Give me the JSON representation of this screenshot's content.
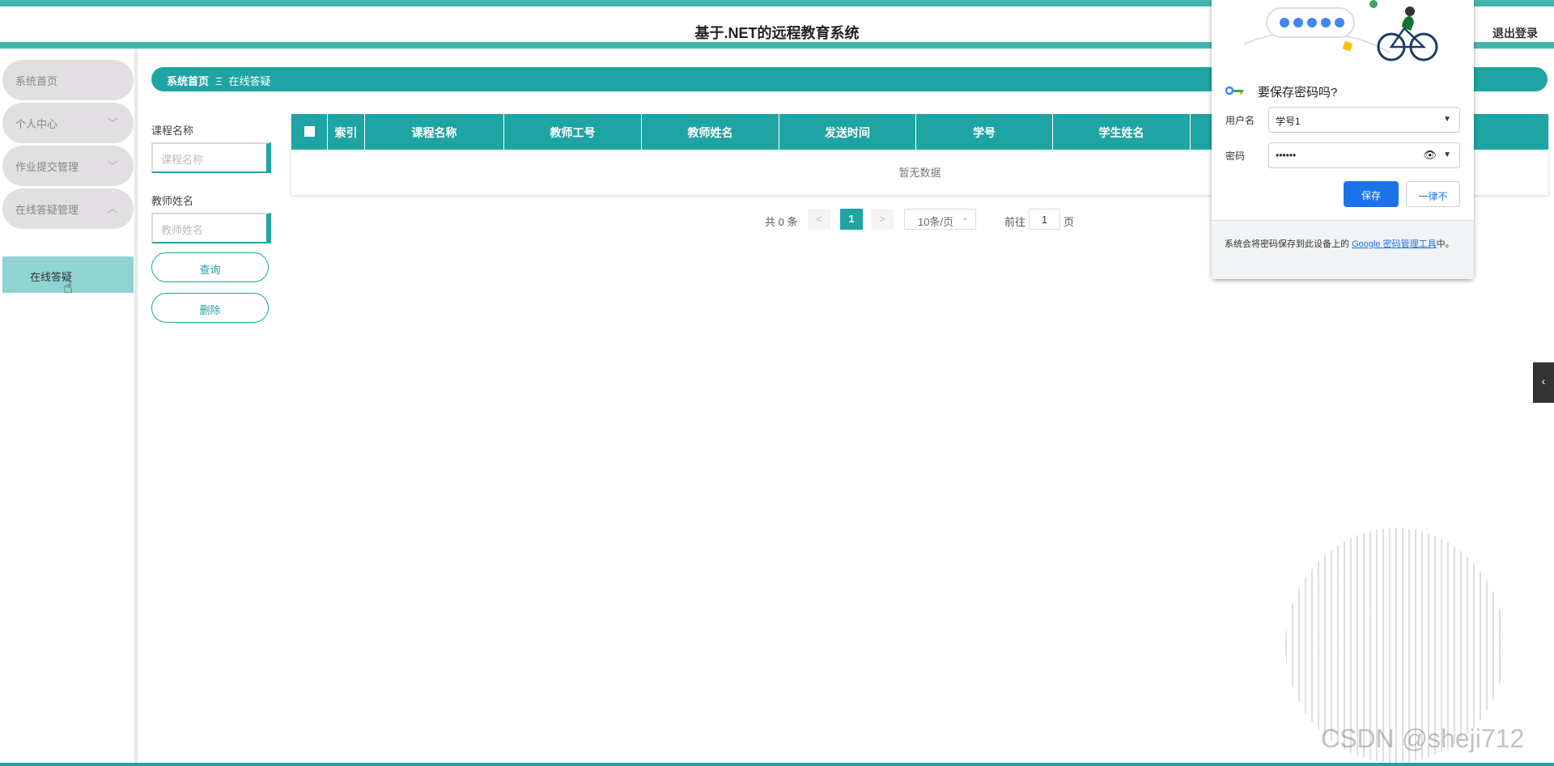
{
  "header": {
    "title": "基于.NET的远程教育系统",
    "logout": "退出登录"
  },
  "sidebar": {
    "items": [
      {
        "label": "系统首页"
      },
      {
        "label": "个人中心",
        "chevron": "﹀"
      },
      {
        "label": "作业提交管理",
        "chevron": "﹀"
      },
      {
        "label": "在线答疑管理",
        "chevron": "︿"
      }
    ],
    "submenu": {
      "label": "在线答疑"
    }
  },
  "breadcrumb": {
    "home": "系统首页",
    "sep": "Ξ",
    "current": "在线答疑"
  },
  "search": {
    "course_label": "课程名称",
    "course_placeholder": "课程名称",
    "teacher_label": "教师姓名",
    "teacher_placeholder": "教师姓名",
    "query_button": "查询",
    "delete_button": "删除"
  },
  "table": {
    "columns": [
      "索引",
      "课程名称",
      "教师工号",
      "教师姓名",
      "发送时间",
      "学号",
      "学生姓名"
    ],
    "empty_text": "暂无数据"
  },
  "pagination": {
    "total": "共 0 条",
    "prev": "<",
    "page": "1",
    "next": ">",
    "page_size": "10条/页",
    "goto_label": "前往",
    "goto_value": "1",
    "goto_suffix": "页"
  },
  "password_popup": {
    "question": "要保存密码吗?",
    "username_label": "用户名",
    "username_value": "学号1",
    "password_label": "密码",
    "password_value": "••••••",
    "save_button": "保存",
    "never_button": "一律不",
    "footer_text": "系统会将密码保存到此设备上的",
    "footer_link": "Google 密码管理工具",
    "footer_suffix": "中。"
  },
  "watermark": "CSDN @sheji712",
  "colors": {
    "accent": "#1ea5a3",
    "google_blue": "#1a73e8"
  }
}
